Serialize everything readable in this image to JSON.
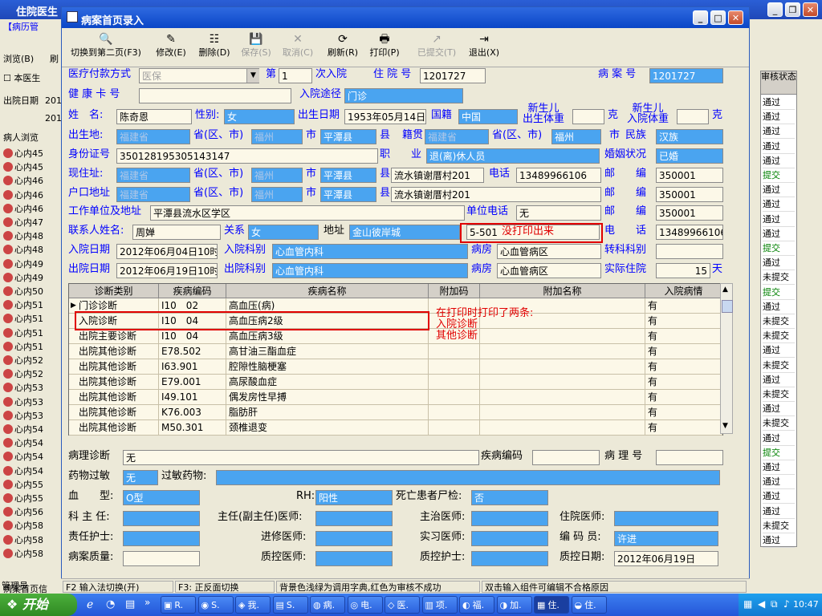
{
  "background_app": {
    "title": "住院医生",
    "menu_fragment": "【病历管",
    "browse_label": "浏览(B)",
    "refresh_fragment": "刷",
    "this_doctor_label": "本医生",
    "discharge_date_label": "出院日期",
    "date_fragment_1": "201",
    "date_fragment_2": "201",
    "patient_browse_tab": "病人浏览",
    "patient_rows": [
      "心内45",
      "心内45",
      "心内46",
      "心内46",
      "心内46",
      "心内47",
      "心内48",
      "心内48",
      "心内49",
      "心内49",
      "心内50",
      "心内51",
      "心内51",
      "心内51",
      "心内51",
      "心内52",
      "心内52",
      "心内53",
      "心内53",
      "心内53",
      "心内54",
      "心内54",
      "心内54",
      "心内54",
      "心内55",
      "心内55",
      "心内56",
      "心内58",
      "心内58",
      "心内58"
    ],
    "status_header": "审核状态",
    "statuses": [
      "通过",
      "通过",
      "通过",
      "通过",
      "通过",
      "提交",
      "通过",
      "通过",
      "通过",
      "通过",
      "提交",
      "通过",
      "未提交",
      "提交",
      "通过",
      "未提交",
      "未提交",
      "通过",
      "未提交",
      "通过",
      "未提交",
      "通过",
      "未提交",
      "通过",
      "提交",
      "通过",
      "通过",
      "通过",
      "通过",
      "未提交",
      "通过"
    ],
    "bottom_left_1": "病案首页信",
    "bottom_left_2": "管理员"
  },
  "dialog": {
    "title": "病案首页录入",
    "toolbar": [
      {
        "label": "切换到第二页(F3)",
        "icon": "magnifier-icon",
        "enabled": true
      },
      {
        "label": "修改(E)",
        "icon": "edit-icon",
        "enabled": true
      },
      {
        "label": "删除(D)",
        "icon": "delete-icon",
        "enabled": true
      },
      {
        "label": "保存(S)",
        "icon": "save-icon",
        "enabled": false
      },
      {
        "label": "取消(C)",
        "icon": "cancel-icon",
        "enabled": false
      },
      {
        "label": "刷新(R)",
        "icon": "refresh-icon",
        "enabled": true
      },
      {
        "label": "打印(P)",
        "icon": "printer-icon",
        "enabled": true
      },
      {
        "label": "已提交(T)",
        "icon": "submit-icon",
        "enabled": false
      },
      {
        "label": "退出(X)",
        "icon": "exit-icon",
        "enabled": true
      }
    ],
    "form": {
      "pay_method_label": "医疗付款方式",
      "pay_method_value": "医保",
      "di_label": "第",
      "admit_count": "1",
      "admit_count_suffix": "次入院",
      "inpatient_no_label": "住 院 号",
      "inpatient_no": "1201727",
      "case_no_label": "病 案 号",
      "case_no": "1201727",
      "health_card_label": "健 康 卡 号",
      "health_card": "",
      "admit_route_label": "入院途径",
      "admit_route": "门诊",
      "name_label": "姓　名:",
      "name": "陈奇恩",
      "sex_label": "性别:",
      "sex": "女",
      "birth_label": "出生日期",
      "birth": "1953年05月14日",
      "nation_label": "国籍",
      "nation": "中国",
      "newborn_weight_label_1": "新生儿",
      "newborn_weight_label_2": "出生体重",
      "newborn_weight": "",
      "kg_1": "克",
      "newborn_admit_weight_label_1": "新生儿",
      "newborn_admit_weight_label_2": "入院体重",
      "newborn_admit_weight": "",
      "kg_2": "克",
      "birthplace_label": "出生地:",
      "birth_province": "福建省",
      "prov_label_1": "省(区、市)",
      "birth_city": "福州",
      "city_label_1": "市",
      "birth_county": "平潭县",
      "county_label_1": "县",
      "native_label": "籍贯",
      "native_province": "福建省",
      "prov_label_2": "省(区、市)",
      "native_city": "福州",
      "city_label_2": "市",
      "ethnic_label": "民族",
      "ethnic": "汉族",
      "id_label": "身份证号",
      "id_no": "350128195305143147",
      "job_label": "职　　业",
      "job": "退(离)休人员",
      "marriage_label": "婚姻状况",
      "marriage": "已婚",
      "curaddr_label": "现住址:",
      "cur_province": "福建省",
      "prov_label_3": "省(区、市)",
      "cur_city": "福州",
      "city_label_3": "市",
      "cur_county": "平潭县",
      "county_label_3": "县",
      "cur_detail": "流水镇谢厝村201",
      "phone_label": "电话",
      "phone": "13489966106",
      "zip_label_1": "邮　　编",
      "zip_1": "350001",
      "hukou_label": "户口地址",
      "hk_province": "福建省",
      "prov_label_4": "省(区、市)",
      "hk_city": "福州",
      "city_label_4": "市",
      "hk_county": "平潭县",
      "county_label_4": "县",
      "hk_detail": "流水镇谢厝村201",
      "zip_label_2": "邮　　编",
      "zip_2": "350001",
      "work_label": "工作单位及地址",
      "work": "平潭县流水区学区",
      "work_phone_label": "单位电话",
      "work_phone": "无",
      "zip_label_3": "邮　　编",
      "zip_3": "350001",
      "contact_label": "联系人姓名:",
      "contact": "周婵",
      "relation_label": "关系",
      "relation": "女",
      "contact_addr_label": "地址",
      "contact_addr": "金山彼岸城",
      "contact_addr_extra": "5-501",
      "contact_phone_label": "电　　话",
      "contact_phone": "13489966106",
      "admit_date_label": "入院日期",
      "admit_date": "2012年06月04日10时",
      "admit_dept_label": "入院科别",
      "admit_dept": "心血管内科",
      "ward_label_1": "病房",
      "ward_1": "心血管病区",
      "transfer_label": "转科科别",
      "transfer": "",
      "discharge_date_label": "出院日期",
      "discharge_date": "2012年06月19日10时",
      "discharge_dept_label": "出院科别",
      "discharge_dept": "心血管内科",
      "ward_label_2": "病房",
      "ward_2": "心血管病区",
      "stay_label": "实际住院",
      "stay_days": "15",
      "stay_unit": "天"
    },
    "grid": {
      "headers": [
        "诊断类别",
        "疾病编码",
        "疾病名称",
        "附加码",
        "附加名称",
        "入院病情"
      ],
      "rows": [
        [
          "门诊诊断",
          "I10　02",
          "高血压(病)",
          "",
          "",
          "有"
        ],
        [
          "入院诊断",
          "I10　04",
          "高血压病2级",
          "",
          "",
          "有"
        ],
        [
          "出院主要诊断",
          "I10　04",
          "高血压病3级",
          "",
          "",
          "有"
        ],
        [
          "出院其他诊断",
          "E78.502",
          "高甘油三酯血症",
          "",
          "",
          "有"
        ],
        [
          "出院其他诊断",
          "I63.901",
          "腔隙性脑梗塞",
          "",
          "",
          "有"
        ],
        [
          "出院其他诊断",
          "E79.001",
          "高尿酸血症",
          "",
          "",
          "有"
        ],
        [
          "出院其他诊断",
          "I49.101",
          "偶发房性早搏",
          "",
          "",
          "有"
        ],
        [
          "出院其他诊断",
          "K76.003",
          "脂肪肝",
          "",
          "",
          "有"
        ],
        [
          "出院其他诊断",
          "M50.301",
          "颈椎退变",
          "",
          "",
          "有"
        ]
      ]
    },
    "lower": {
      "path_label": "病理诊断",
      "path_value": "无",
      "disease_code_label": "疾病编码",
      "disease_code": "",
      "path_no_label": "病 理 号",
      "path_no": "",
      "allergy_label": "药物过敏",
      "allergy": "无",
      "allergy_drug_label": "过敏药物:",
      "allergy_drug": "",
      "blood_label": "血　　型:",
      "blood": "O型",
      "rh_label": "RH:",
      "rh": "阳性",
      "autopsy_label": "死亡患者尸检:",
      "autopsy": "否",
      "director_label": "科 主 任:",
      "director": "",
      "chief_label": "主任(副主任)医师:",
      "chief": "",
      "attending_label": "主治医师:",
      "attending": "",
      "resident_label": "住院医师:",
      "resident": "",
      "nurse_label": "责任护士:",
      "nurse": "",
      "advanced_label": "进修医师:",
      "advanced": "",
      "intern_label": "实习医师:",
      "intern": "",
      "coder_label": "编 码 员:",
      "coder": "许进",
      "quality_label": "病案质量:",
      "quality": "",
      "qc_doctor_label": "质控医师:",
      "qc_doctor": "",
      "qc_nurse_label": "质控护士:",
      "qc_nurse": "",
      "qc_date_label": "质控日期:",
      "qc_date": "2012年06月19日"
    },
    "annotations": {
      "not_printed": "没打印出来",
      "printed_twice": "在打印时打印了两条:\n入院诊断\n其他诊断"
    },
    "statusbar": [
      "F2 输入法切换(开)",
      "F3: 正反面切换",
      "背景色浅绿为调用字典,红色为审核不成功",
      "双击输入组件可编辑不合格原因"
    ]
  },
  "taskbar": {
    "start_label": "开始",
    "tasks": [
      "R.",
      "S.",
      "我.",
      "S.",
      "病.",
      "电.",
      "医.",
      "项.",
      "福.",
      "加.",
      "住.",
      "住."
    ],
    "clock": "10:47"
  }
}
